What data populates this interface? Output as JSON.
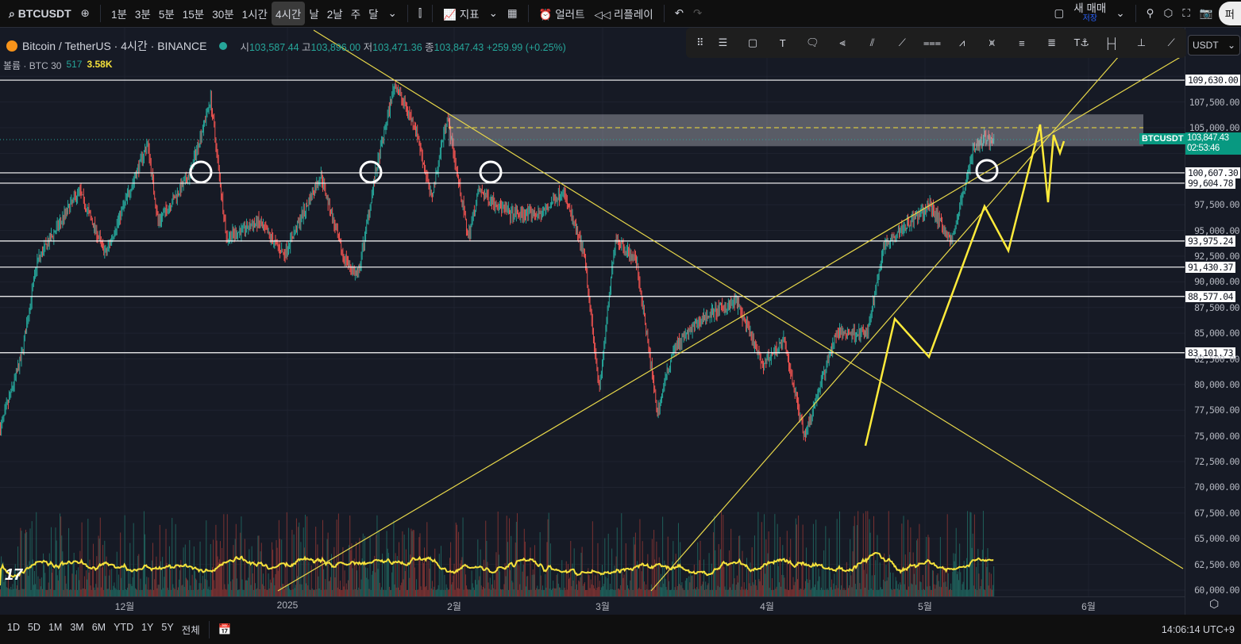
{
  "topbar": {
    "symbol": "BTCUSDT",
    "intervals": [
      "1분",
      "3분",
      "5분",
      "15분",
      "30분",
      "1시간",
      "4시간",
      "날",
      "2날",
      "주",
      "달"
    ],
    "active_interval": "4시간",
    "indicators_label": "지표",
    "alert_label": "얼러트",
    "replay_label": "리플레이",
    "trade_label": "새 매매",
    "save_label": "저장",
    "publish_label": "퍼"
  },
  "legend": {
    "title": "Bitcoin / TetherUS · 4시간 · BINANCE",
    "open_label": "시",
    "open": "103,587.44",
    "high_label": "고",
    "high": "103,896.00",
    "low_label": "저",
    "low": "103,471.36",
    "close_label": "종",
    "close": "103,847.43",
    "change": "+259.99 (+0.25%)",
    "volume_label": "볼륨 · BTC 30",
    "volume_ma": "517",
    "volume": "3.58K"
  },
  "currency_select": "USDT",
  "colors": {
    "up": "#26a69a",
    "down": "#ef5350",
    "drawing": "#f5e13b",
    "level": "#ffffff",
    "background": "#161a25"
  },
  "chart_data": {
    "type": "candlestick",
    "symbol": "BTCUSDT",
    "interval": "4h",
    "ylim": [
      60000,
      110500
    ],
    "price_ticks": [
      "107,500.00",
      "105,000.00",
      "97,500.00",
      "95,000.00",
      "92,500.00",
      "90,000.00",
      "87,500.00",
      "85,000.00",
      "82,500.00",
      "80,000.00",
      "77,500.00",
      "75,000.00",
      "72,500.00",
      "70,000.00",
      "67,500.00",
      "65,000.00",
      "62,500.00",
      "60,000.00"
    ],
    "time_ticks": [
      "12월",
      "2025",
      "2월",
      "3월",
      "4월",
      "5월",
      "6월"
    ],
    "horizontal_levels": [
      "109,630.00",
      "100,607.30",
      "99,604.78",
      "93,975.24",
      "91,430.37",
      "88,577.04",
      "83,101.73"
    ],
    "last_price": "103,847.43",
    "countdown": "02:53:46",
    "last_price_tag": "BTCUSDT",
    "approx_price_path": [
      [
        "2024-11-07",
        75700
      ],
      [
        "2024-11-11",
        82700
      ],
      [
        "2024-11-14",
        92000
      ],
      [
        "2024-11-22",
        98900
      ],
      [
        "2024-11-27",
        92700
      ],
      [
        "2024-12-05",
        103500
      ],
      [
        "2024-12-07",
        95800
      ],
      [
        "2024-12-13",
        100400
      ],
      [
        "2024-12-17",
        107800
      ],
      [
        "2024-12-20",
        94300
      ],
      [
        "2024-12-26",
        95800
      ],
      [
        "2024-12-31",
        92700
      ],
      [
        "2025-01-07",
        100400
      ],
      [
        "2025-01-11",
        92700
      ],
      [
        "2025-01-14",
        90400
      ],
      [
        "2025-01-17",
        99600
      ],
      [
        "2025-01-21",
        109300
      ],
      [
        "2025-01-25",
        105000
      ],
      [
        "2025-01-28",
        98100
      ],
      [
        "2025-01-31",
        106200
      ],
      [
        "2025-02-04",
        94300
      ],
      [
        "2025-02-06",
        98900
      ],
      [
        "2025-02-12",
        96600
      ],
      [
        "2025-02-18",
        96600
      ],
      [
        "2025-02-22",
        98900
      ],
      [
        "2025-02-26",
        92700
      ],
      [
        "2025-03-01",
        79600
      ],
      [
        "2025-03-04",
        94300
      ],
      [
        "2025-03-08",
        92000
      ],
      [
        "2025-03-12",
        77300
      ],
      [
        "2025-03-15",
        83500
      ],
      [
        "2025-03-21",
        86600
      ],
      [
        "2025-03-27",
        88100
      ],
      [
        "2025-04-01",
        81900
      ],
      [
        "2025-04-05",
        84300
      ],
      [
        "2025-04-09",
        75000
      ],
      [
        "2025-04-15",
        85000
      ],
      [
        "2025-04-21",
        85000
      ],
      [
        "2025-04-24",
        93500
      ],
      [
        "2025-04-27",
        95000
      ],
      [
        "2025-05-03",
        97400
      ],
      [
        "2025-05-07",
        93900
      ],
      [
        "2025-05-11",
        102700
      ],
      [
        "2025-05-13",
        103900
      ],
      [
        "2025-05-15",
        103847
      ]
    ]
  },
  "bottombar": {
    "ranges": [
      "1D",
      "5D",
      "1M",
      "3M",
      "6M",
      "YTD",
      "1Y",
      "5Y",
      "전체"
    ],
    "clock": "14:06:14 UTC+9"
  }
}
